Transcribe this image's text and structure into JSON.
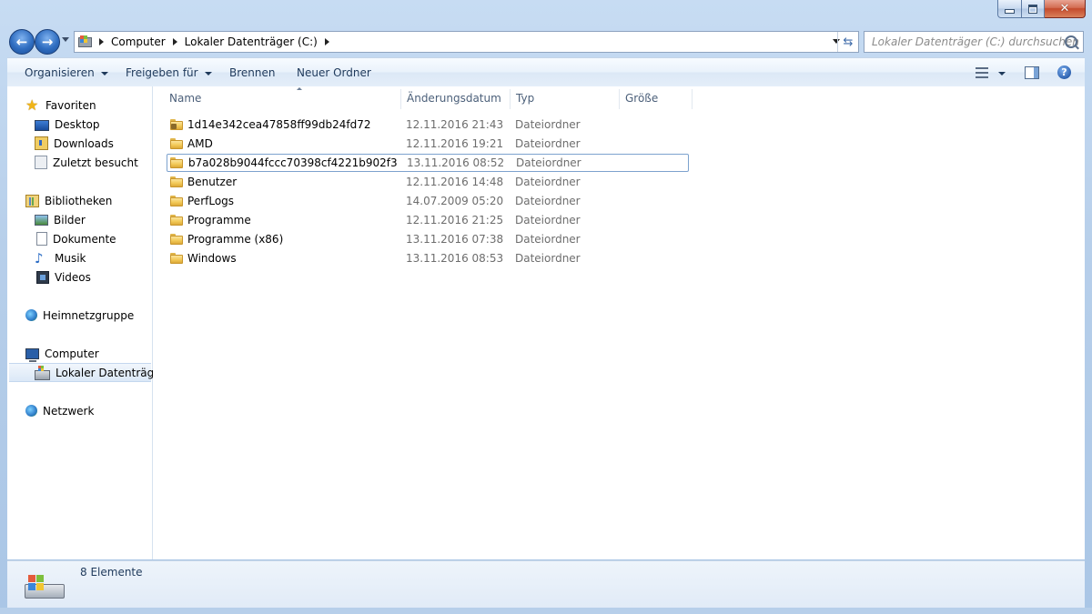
{
  "window": {
    "buttons": {
      "minimize": "minimize",
      "maximize": "maximize",
      "close": "close"
    }
  },
  "navigation": {
    "back": "back",
    "forward": "forward",
    "breadcrumbs": [
      "Computer",
      "Lokaler Datenträger (C:)"
    ],
    "search_placeholder": "Lokaler Datenträger (C:) durchsuchen"
  },
  "toolbar": {
    "organize": "Organisieren",
    "share": "Freigeben für",
    "burn": "Brennen",
    "new_folder": "Neuer Ordner",
    "help_glyph": "?"
  },
  "sidebar": {
    "favorites": {
      "label": "Favoriten",
      "items": [
        "Desktop",
        "Downloads",
        "Zuletzt besucht"
      ]
    },
    "libraries": {
      "label": "Bibliotheken",
      "items": [
        "Bilder",
        "Dokumente",
        "Musik",
        "Videos"
      ]
    },
    "homegroup": "Heimnetzgruppe",
    "computer": {
      "label": "Computer",
      "items": [
        "Lokaler Datenträger"
      ]
    },
    "network": "Netzwerk"
  },
  "file_list": {
    "columns": [
      "Name",
      "Änderungsdatum",
      "Typ",
      "Größe"
    ],
    "rows": [
      {
        "name": "1d14e342cea47858ff99db24fd72",
        "date": "12.11.2016 21:43",
        "type": "Dateiordner",
        "locked": true
      },
      {
        "name": "AMD",
        "date": "12.11.2016 19:21",
        "type": "Dateiordner"
      },
      {
        "name": "b7a028b9044fccc70398cf4221b902f3",
        "date": "13.11.2016 08:52",
        "type": "Dateiordner",
        "focused": true
      },
      {
        "name": "Benutzer",
        "date": "12.11.2016 14:48",
        "type": "Dateiordner"
      },
      {
        "name": "PerfLogs",
        "date": "14.07.2009 05:20",
        "type": "Dateiordner"
      },
      {
        "name": "Programme",
        "date": "12.11.2016 21:25",
        "type": "Dateiordner"
      },
      {
        "name": "Programme (x86)",
        "date": "13.11.2016 07:38",
        "type": "Dateiordner"
      },
      {
        "name": "Windows",
        "date": "13.11.2016 08:53",
        "type": "Dateiordner"
      }
    ]
  },
  "status": {
    "item_count": "8 Elemente"
  },
  "colors": {
    "accent": "#1e395b",
    "selection_border": "#7da2ce",
    "folder": "#f1c753",
    "close_button": "#c44a2c"
  }
}
